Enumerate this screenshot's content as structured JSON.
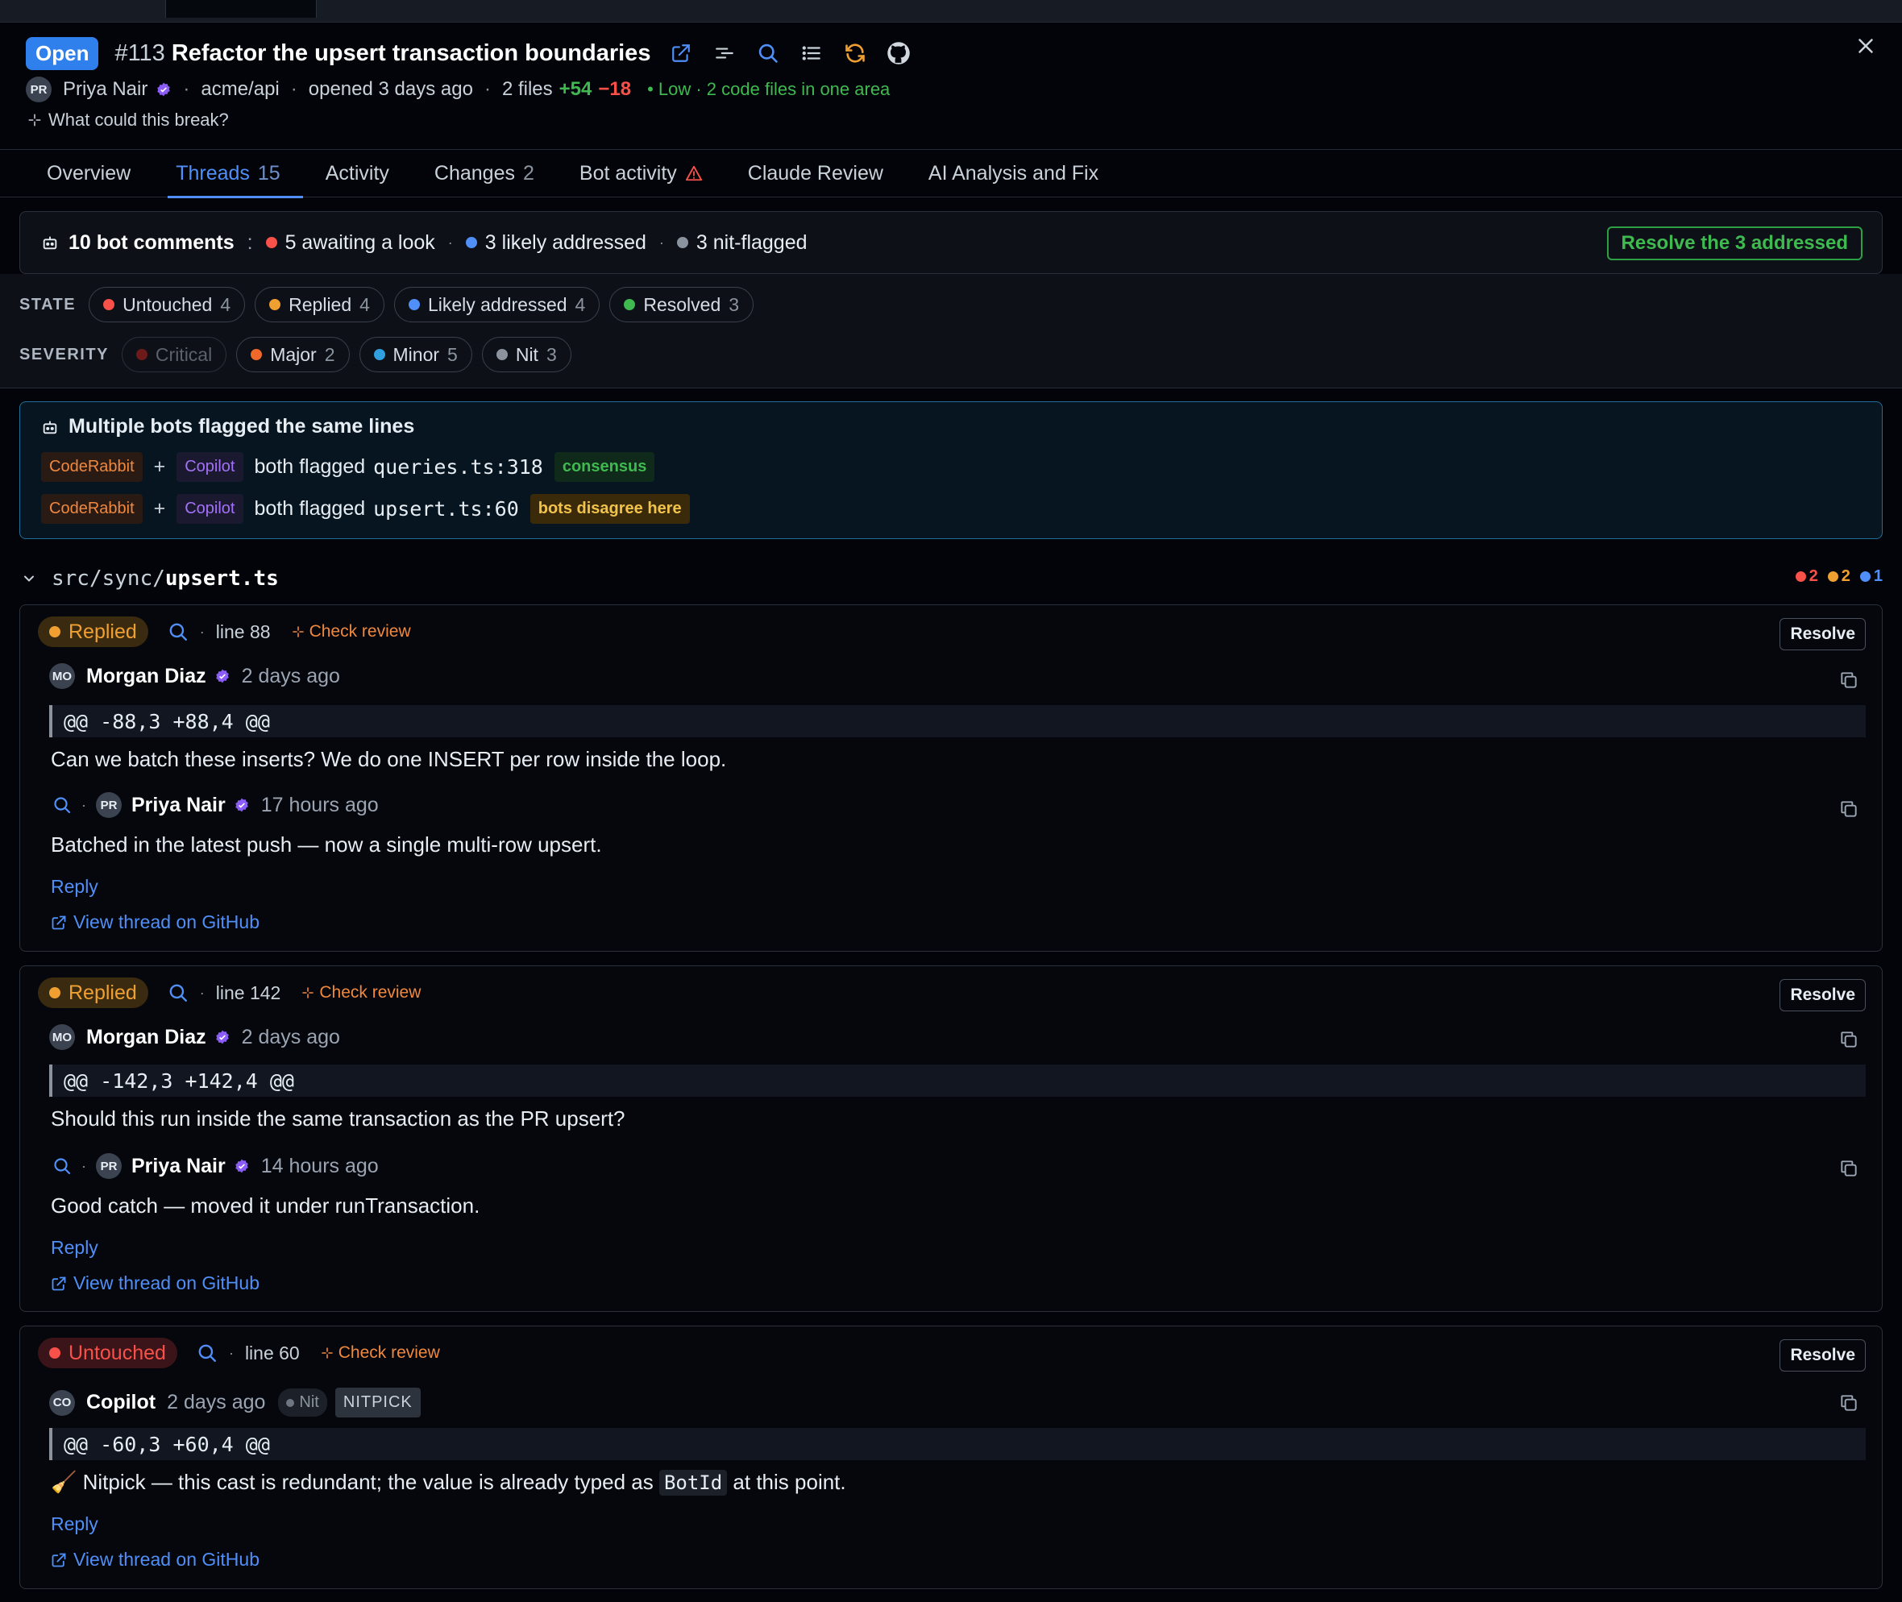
{
  "header": {
    "state_badge": "Open",
    "pr_number": "#113",
    "title": "Refactor the upsert transaction boundaries",
    "author_initials": "PR",
    "author": "Priya Nair",
    "repo": "acme/api",
    "opened": "opened 3 days ago",
    "files": "2 files",
    "additions": "+54",
    "deletions": "−18",
    "risk": "•  Low · 2 code files in one area",
    "prompt": "What could this break?",
    "icons": [
      "external-link-icon",
      "align-icon",
      "search-icon",
      "list-icon",
      "sync-icon",
      "github-icon",
      "close-icon"
    ]
  },
  "tabs": [
    {
      "label": "Overview",
      "count": ""
    },
    {
      "label": "Threads",
      "count": "15"
    },
    {
      "label": "Activity",
      "count": ""
    },
    {
      "label": "Changes",
      "count": "2"
    },
    {
      "label": "Bot activity",
      "count": ""
    },
    {
      "label": "Claude Review",
      "count": ""
    },
    {
      "label": "AI Analysis and Fix",
      "count": ""
    }
  ],
  "summary": {
    "bot_comments": "10 bot comments",
    "colon": ":",
    "awaiting": "5 awaiting a look",
    "likely": "3 likely addressed",
    "nit": "3 nit-flagged",
    "resolve_all": "Resolve the 3 addressed"
  },
  "filters": {
    "state_label": "STATE",
    "state": [
      {
        "label": "Untouched",
        "count": "4",
        "color": "#f85149"
      },
      {
        "label": "Replied",
        "count": "4",
        "color": "#f0a030"
      },
      {
        "label": "Likely addressed",
        "count": "4",
        "color": "#4f8ff7"
      },
      {
        "label": "Resolved",
        "count": "3",
        "color": "#3fb950"
      }
    ],
    "severity_label": "SEVERITY",
    "severity": [
      {
        "label": "Critical",
        "count": "",
        "color": "#6e1a1a"
      },
      {
        "label": "Major",
        "count": "2",
        "color": "#f0682a"
      },
      {
        "label": "Minor",
        "count": "5",
        "color": "#2f9fe0"
      },
      {
        "label": "Nit",
        "count": "3",
        "color": "#8b949e"
      }
    ]
  },
  "bots": {
    "title": "Multiple bots flagged the same lines",
    "rows": [
      {
        "bot_a": "CodeRabbit",
        "bot_b": "Copilot",
        "text": "both flagged ",
        "loc": "queries.ts:318",
        "tag": "consensus"
      },
      {
        "bot_a": "CodeRabbit",
        "bot_b": "Copilot",
        "text": "both flagged ",
        "loc": "upsert.ts:60",
        "tag": "bots disagree here"
      }
    ]
  },
  "file": {
    "dir": "src/sync/",
    "name": "upsert.ts",
    "counts": [
      {
        "n": "2",
        "color": "#f85149"
      },
      {
        "n": "2",
        "color": "#f0a030"
      },
      {
        "n": "1",
        "color": "#4f8ff7"
      }
    ]
  },
  "threads": [
    {
      "status": "Replied",
      "line": "line 88",
      "check": "Check review",
      "resolve": "Resolve",
      "author_initials": "MO",
      "author": "Morgan Diaz",
      "time": "2 days ago",
      "hunk": "@@ -88,3 +88,4 @@",
      "body": "Can we batch these inserts? We do one INSERT per row inside the loop.",
      "reply_initials": "PR",
      "reply_author": "Priya Nair",
      "reply_time": "17 hours ago",
      "reply_body": "Batched in the latest push — now a single multi-row upsert.",
      "reply_link": "Reply",
      "github_link": "View thread on GitHub"
    },
    {
      "status": "Replied",
      "line": "line 142",
      "check": "Check review",
      "resolve": "Resolve",
      "author_initials": "MO",
      "author": "Morgan Diaz",
      "time": "2 days ago",
      "hunk": "@@ -142,3 +142,4 @@",
      "body": "Should this run inside the same transaction as the PR upsert?",
      "reply_initials": "PR",
      "reply_author": "Priya Nair",
      "reply_time": "14 hours ago",
      "reply_body": "Good catch — moved it under runTransaction.",
      "reply_link": "Reply",
      "github_link": "View thread on GitHub"
    },
    {
      "status": "Untouched",
      "line": "line 60",
      "check": "Check review",
      "resolve": "Resolve",
      "author_initials": "CO",
      "author": "Copilot",
      "time": "2 days ago",
      "severity": "Nit",
      "tag": "NITPICK",
      "hunk": "@@ -60,3 +60,4 @@",
      "body_pre": "🧹  Nitpick — this cast is redundant; the value is already typed as ",
      "body_code": "BotId",
      "body_post": " at this point.",
      "reply_link": "Reply",
      "github_link": "View thread on GitHub"
    }
  ]
}
